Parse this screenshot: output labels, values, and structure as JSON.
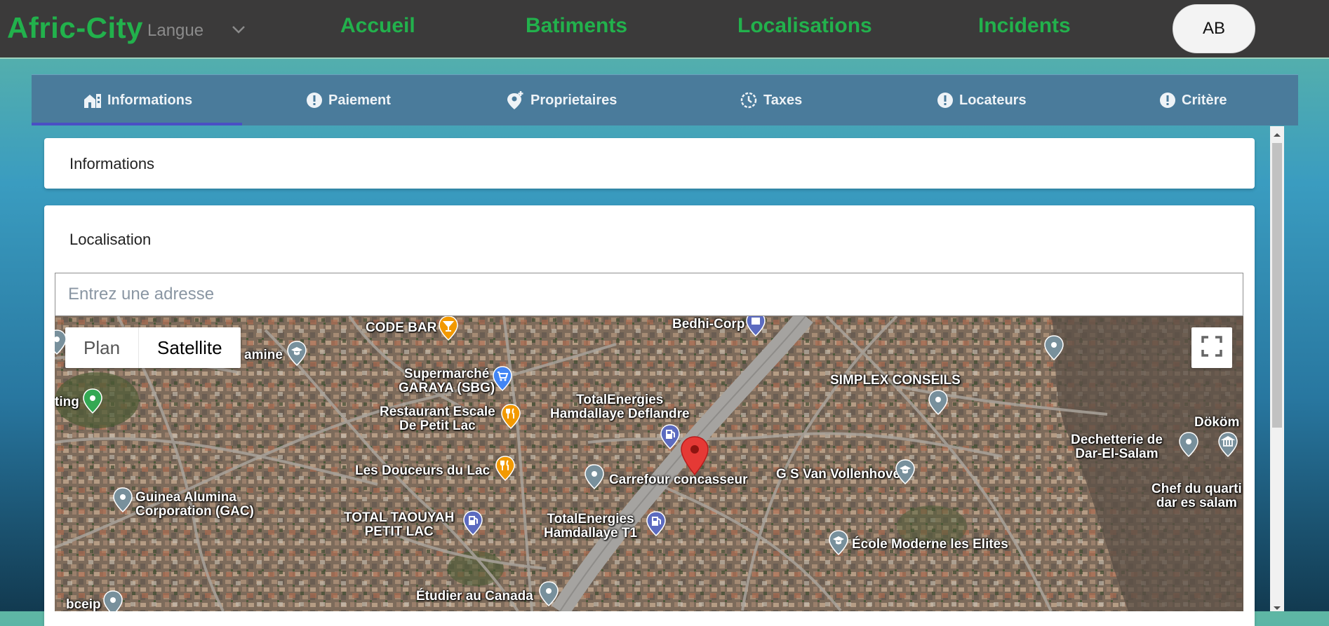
{
  "header": {
    "brand": "Afric-City",
    "language_label": "Langue",
    "nav": [
      "Accueil",
      "Batiments",
      "Localisations",
      "Incidents"
    ],
    "avatar_initials": "AB"
  },
  "tabs": [
    {
      "label": "Informations",
      "icon": "building-icon",
      "active": true
    },
    {
      "label": "Paiement",
      "icon": "alert-circle-icon"
    },
    {
      "label": "Proprietaires",
      "icon": "person-pin-icon"
    },
    {
      "label": "Taxes",
      "icon": "clock-history-icon"
    },
    {
      "label": "Locateurs",
      "icon": "alert-circle-icon"
    },
    {
      "label": "Critère",
      "icon": "alert-circle-icon"
    }
  ],
  "cards": {
    "informations_title": "Informations",
    "localisation_title": "Localisation"
  },
  "address": {
    "placeholder": "Entrez une adresse",
    "value": ""
  },
  "map": {
    "type_plan": "Plan",
    "type_satellite": "Satellite",
    "selected_type": "Satellite",
    "places": [
      {
        "label": "CODE BAR",
        "icon": "bar-icon"
      },
      {
        "label": "Bedhi-Corp",
        "icon": "shopping-bag-icon"
      },
      {
        "label": "amine",
        "icon": "school-icon"
      },
      {
        "label": "Supermarché\nGARAYA (SBG)",
        "icon": "cart-icon"
      },
      {
        "label": "Restaurant Escale\nDe Petit Lac",
        "icon": "restaurant-icon"
      },
      {
        "label": "TotalEnergies\nHamdallaye Deflandre",
        "icon": "gas-station-icon"
      },
      {
        "label": "SIMPLEX CONSEILS",
        "icon": "place-icon"
      },
      {
        "label": "Dököm",
        "icon": "museum-icon"
      },
      {
        "label": "Dechetterie de\nDar-El-Salam",
        "icon": "place-icon"
      },
      {
        "label": "ting",
        "icon": "park-icon"
      },
      {
        "label": "Les Douceurs du Lac",
        "icon": "restaurant-icon"
      },
      {
        "label": "Carrefour concasseur",
        "icon": "place-icon"
      },
      {
        "label": "G S Van Vollenhoven",
        "icon": "school-icon"
      },
      {
        "label": "Guinea Alumina\nCorporation (GAC)",
        "icon": "place-icon"
      },
      {
        "label": "TOTAL TAOUYAH\nPETIT LAC",
        "icon": "gas-station-icon"
      },
      {
        "label": "TotalEnergies\nHamdallaye T1",
        "icon": "gas-station-icon"
      },
      {
        "label": "Chef du quarti\ndar es salam",
        "icon": "place-icon"
      },
      {
        "label": "École Moderne les Elites",
        "icon": "school-icon"
      },
      {
        "label": "Étudier au Canada",
        "icon": "place-icon"
      },
      {
        "label": "bceip",
        "icon": "place-icon"
      }
    ]
  },
  "colors": {
    "brand_green": "#22b14c",
    "topbar": "#3b3a3a",
    "tabs_bg": "#4a7b9b",
    "tab_active_underline": "#4a4fc4",
    "marker_red": "#e53935"
  }
}
